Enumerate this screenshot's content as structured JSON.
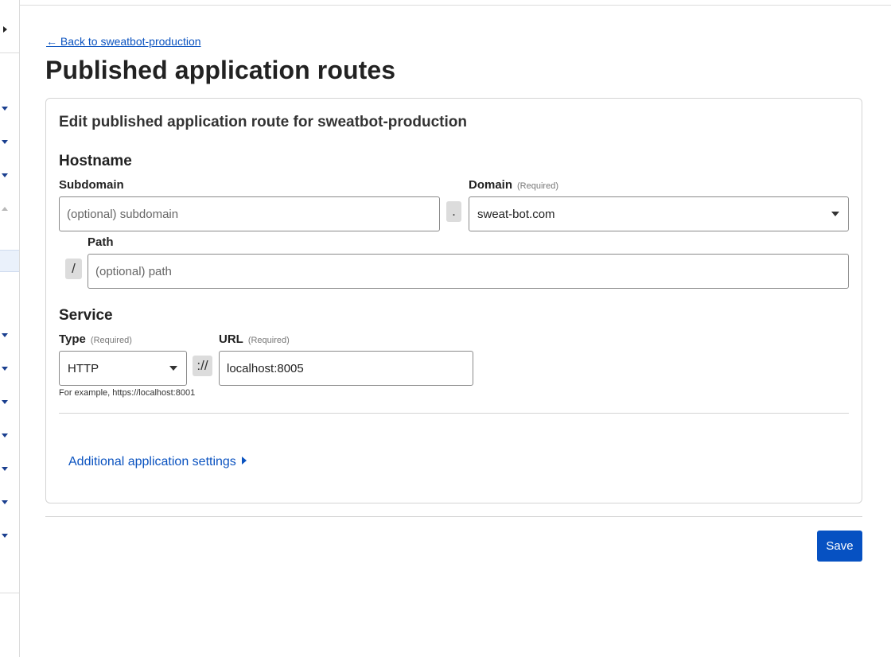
{
  "nav": {
    "back_link": "← Back to sweatbot-production"
  },
  "page": {
    "title": "Published application routes"
  },
  "form": {
    "title": "Edit published application route for sweatbot-production",
    "hostname": {
      "heading": "Hostname",
      "subdomain": {
        "label": "Subdomain",
        "value": "",
        "placeholder": "(optional) subdomain"
      },
      "dot": ".",
      "domain": {
        "label": "Domain",
        "required": "(Required)",
        "value": "sweat-bot.com"
      },
      "slash": "/",
      "path": {
        "label": "Path",
        "value": "",
        "placeholder": "(optional) path"
      }
    },
    "service": {
      "heading": "Service",
      "type": {
        "label": "Type",
        "required": "(Required)",
        "value": "HTTP"
      },
      "scheme_sep": "://",
      "url": {
        "label": "URL",
        "required": "(Required)",
        "value": "localhost:8005"
      },
      "help": "For example, https://localhost:8001"
    },
    "additional_settings": "Additional application settings"
  },
  "actions": {
    "save": "Save"
  },
  "colors": {
    "primary": "#0651c2",
    "link": "#0b53c0"
  }
}
